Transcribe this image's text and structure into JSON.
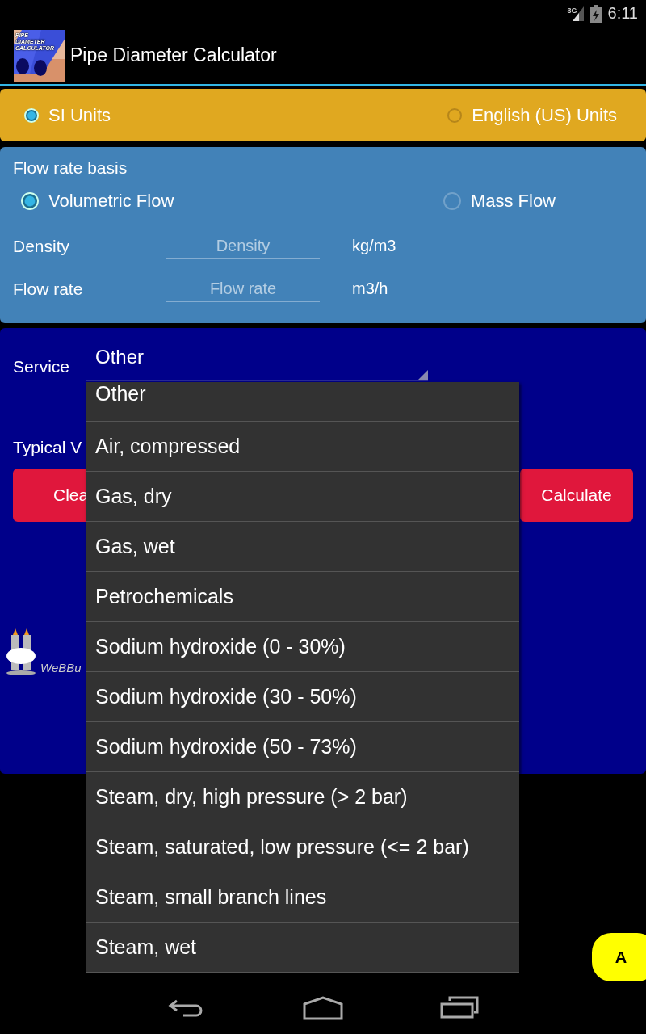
{
  "status_bar": {
    "network": "3G",
    "time": "6:11"
  },
  "app_bar": {
    "icon_text": [
      "PIPE",
      "DIAMETER",
      "CALCULATOR"
    ],
    "title": "Pipe Diameter Calculator"
  },
  "units": [
    {
      "label": "SI Units",
      "selected": true
    },
    {
      "label": "English (US) Units",
      "selected": false
    }
  ],
  "flow": {
    "heading": "Flow rate basis",
    "basis": [
      {
        "label": "Volumetric Flow",
        "selected": true
      },
      {
        "label": "Mass Flow",
        "selected": false
      }
    ],
    "fields": [
      {
        "label": "Density",
        "placeholder": "Density",
        "unit": "kg/m3"
      },
      {
        "label": "Flow rate",
        "placeholder": "Flow rate",
        "unit": "m3/h"
      }
    ]
  },
  "service": {
    "label": "Service",
    "value": "Other",
    "typical_label": "Typical V",
    "buttons": [
      "Clea",
      "Calculate"
    ],
    "logo_text": "WeBBu"
  },
  "dropdown": {
    "options": [
      "Other",
      "Air, compressed",
      "Gas, dry",
      "Gas, wet",
      "Petrochemicals",
      "Sodium hydroxide (0 - 30%)",
      "Sodium hydroxide (30 - 50%)",
      "Sodium hydroxide (50 - 73%)",
      "Steam, dry, high pressure (> 2 bar)",
      "Steam, saturated, low pressure (<= 2 bar)",
      "Steam, small branch lines",
      "Steam, wet"
    ]
  },
  "floating_button": "A"
}
